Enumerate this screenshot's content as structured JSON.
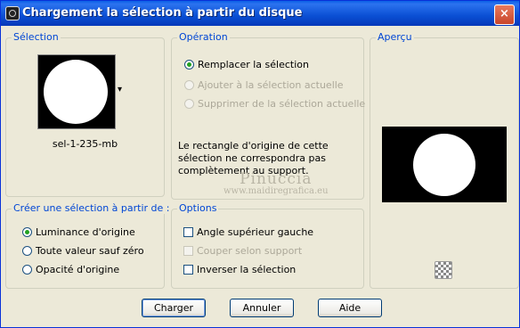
{
  "window": {
    "title": "Chargement la sélection à partir du disque",
    "close_glyph": "×"
  },
  "selection": {
    "group_label": "Sélection",
    "preset_name": "sel-1-235-mb",
    "dropdown_glyph": "▾"
  },
  "operation": {
    "group_label": "Opération",
    "options": [
      {
        "label": "Remplacer la sélection",
        "checked": true,
        "disabled": false
      },
      {
        "label": "Ajouter à la sélection actuelle",
        "checked": false,
        "disabled": true
      },
      {
        "label": "Supprimer de la sélection actuelle",
        "checked": false,
        "disabled": true
      }
    ],
    "message": "Le rectangle d'origine de cette sélection ne correspondra pas complètement au support."
  },
  "preview": {
    "group_label": "Aperçu"
  },
  "create_from": {
    "group_label": "Créer une sélection à partir de :",
    "options": [
      {
        "label": "Luminance d'origine",
        "checked": true
      },
      {
        "label": "Toute valeur sauf zéro",
        "checked": false
      },
      {
        "label": "Opacité d'origine",
        "checked": false
      }
    ]
  },
  "options": {
    "group_label": "Options",
    "items": [
      {
        "label": "Angle supérieur gauche",
        "checked": false,
        "disabled": false
      },
      {
        "label": "Couper selon support",
        "checked": false,
        "disabled": true
      },
      {
        "label": "Inverser la sélection",
        "checked": false,
        "disabled": false
      }
    ]
  },
  "buttons": {
    "load": "Charger",
    "cancel": "Annuler",
    "help": "Aide"
  },
  "watermark": {
    "line1": "Pinuccia",
    "line2": "www.maidiregrafica.eu"
  },
  "colors": {
    "title_bar": "#0a4fd4",
    "group_label": "#0046d5",
    "radio_checked": "#21a121"
  }
}
